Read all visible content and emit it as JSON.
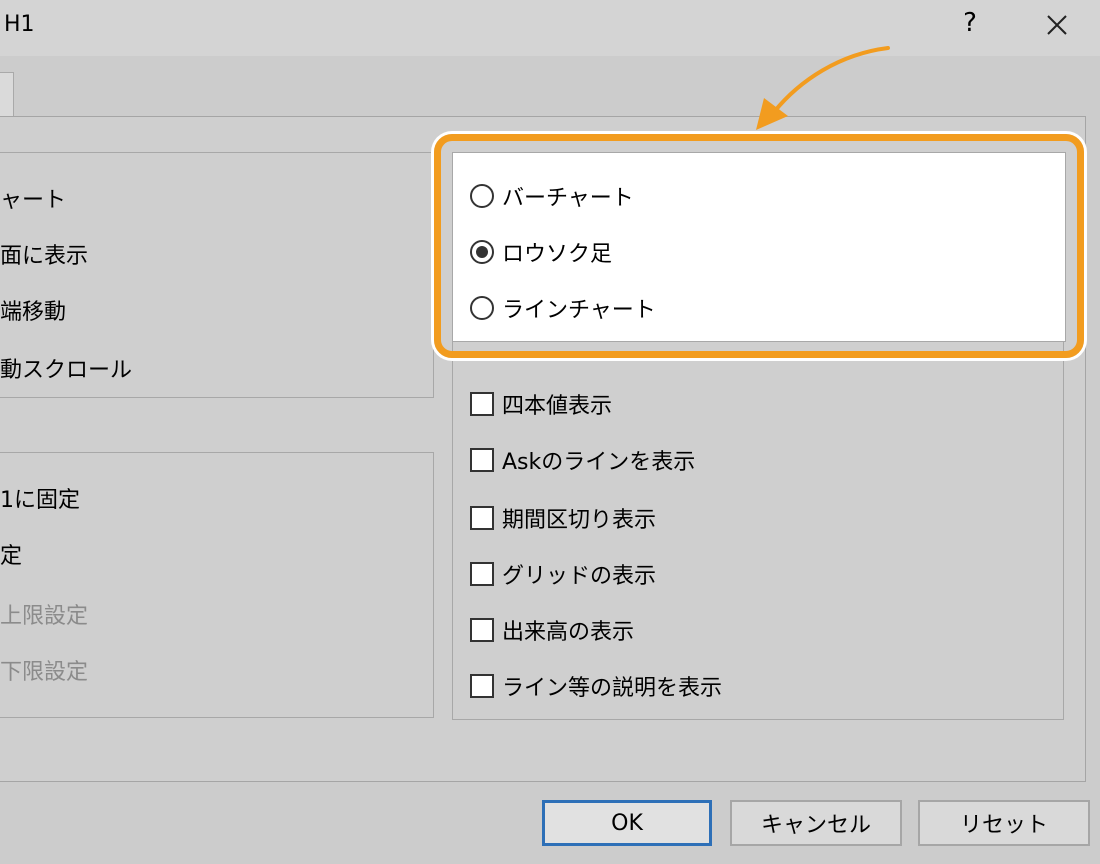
{
  "window": {
    "title": "H1",
    "help_label": "?",
    "close_icon": "close-icon"
  },
  "left_group_1": {
    "items": [
      {
        "label": "ャート"
      },
      {
        "label": "面に表示"
      },
      {
        "label": "端移動"
      },
      {
        "label": "動スクロール"
      }
    ]
  },
  "left_group_2": {
    "items": [
      {
        "label": "1に固定",
        "disabled": false
      },
      {
        "label": "定",
        "disabled": false
      },
      {
        "label": "上限設定",
        "disabled": true
      },
      {
        "label": "下限設定",
        "disabled": true
      }
    ]
  },
  "chart_type": {
    "options": [
      {
        "label": "バーチャート",
        "selected": false
      },
      {
        "label": "ロウソク足",
        "selected": true
      },
      {
        "label": "ラインチャート",
        "selected": false
      }
    ]
  },
  "checkboxes": [
    {
      "label": "四本値表示",
      "checked": false
    },
    {
      "label": "Askのラインを表示",
      "checked": false
    },
    {
      "label": "期間区切り表示",
      "checked": false
    },
    {
      "label": "グリッドの表示",
      "checked": false
    },
    {
      "label": "出来高の表示",
      "checked": false
    },
    {
      "label": "ライン等の説明を表示",
      "checked": false
    }
  ],
  "buttons": {
    "ok": "OK",
    "cancel": "キャンセル",
    "reset": "リセット"
  },
  "colors": {
    "highlight": "#f29c1f",
    "ok_border": "#2d6fb7"
  }
}
